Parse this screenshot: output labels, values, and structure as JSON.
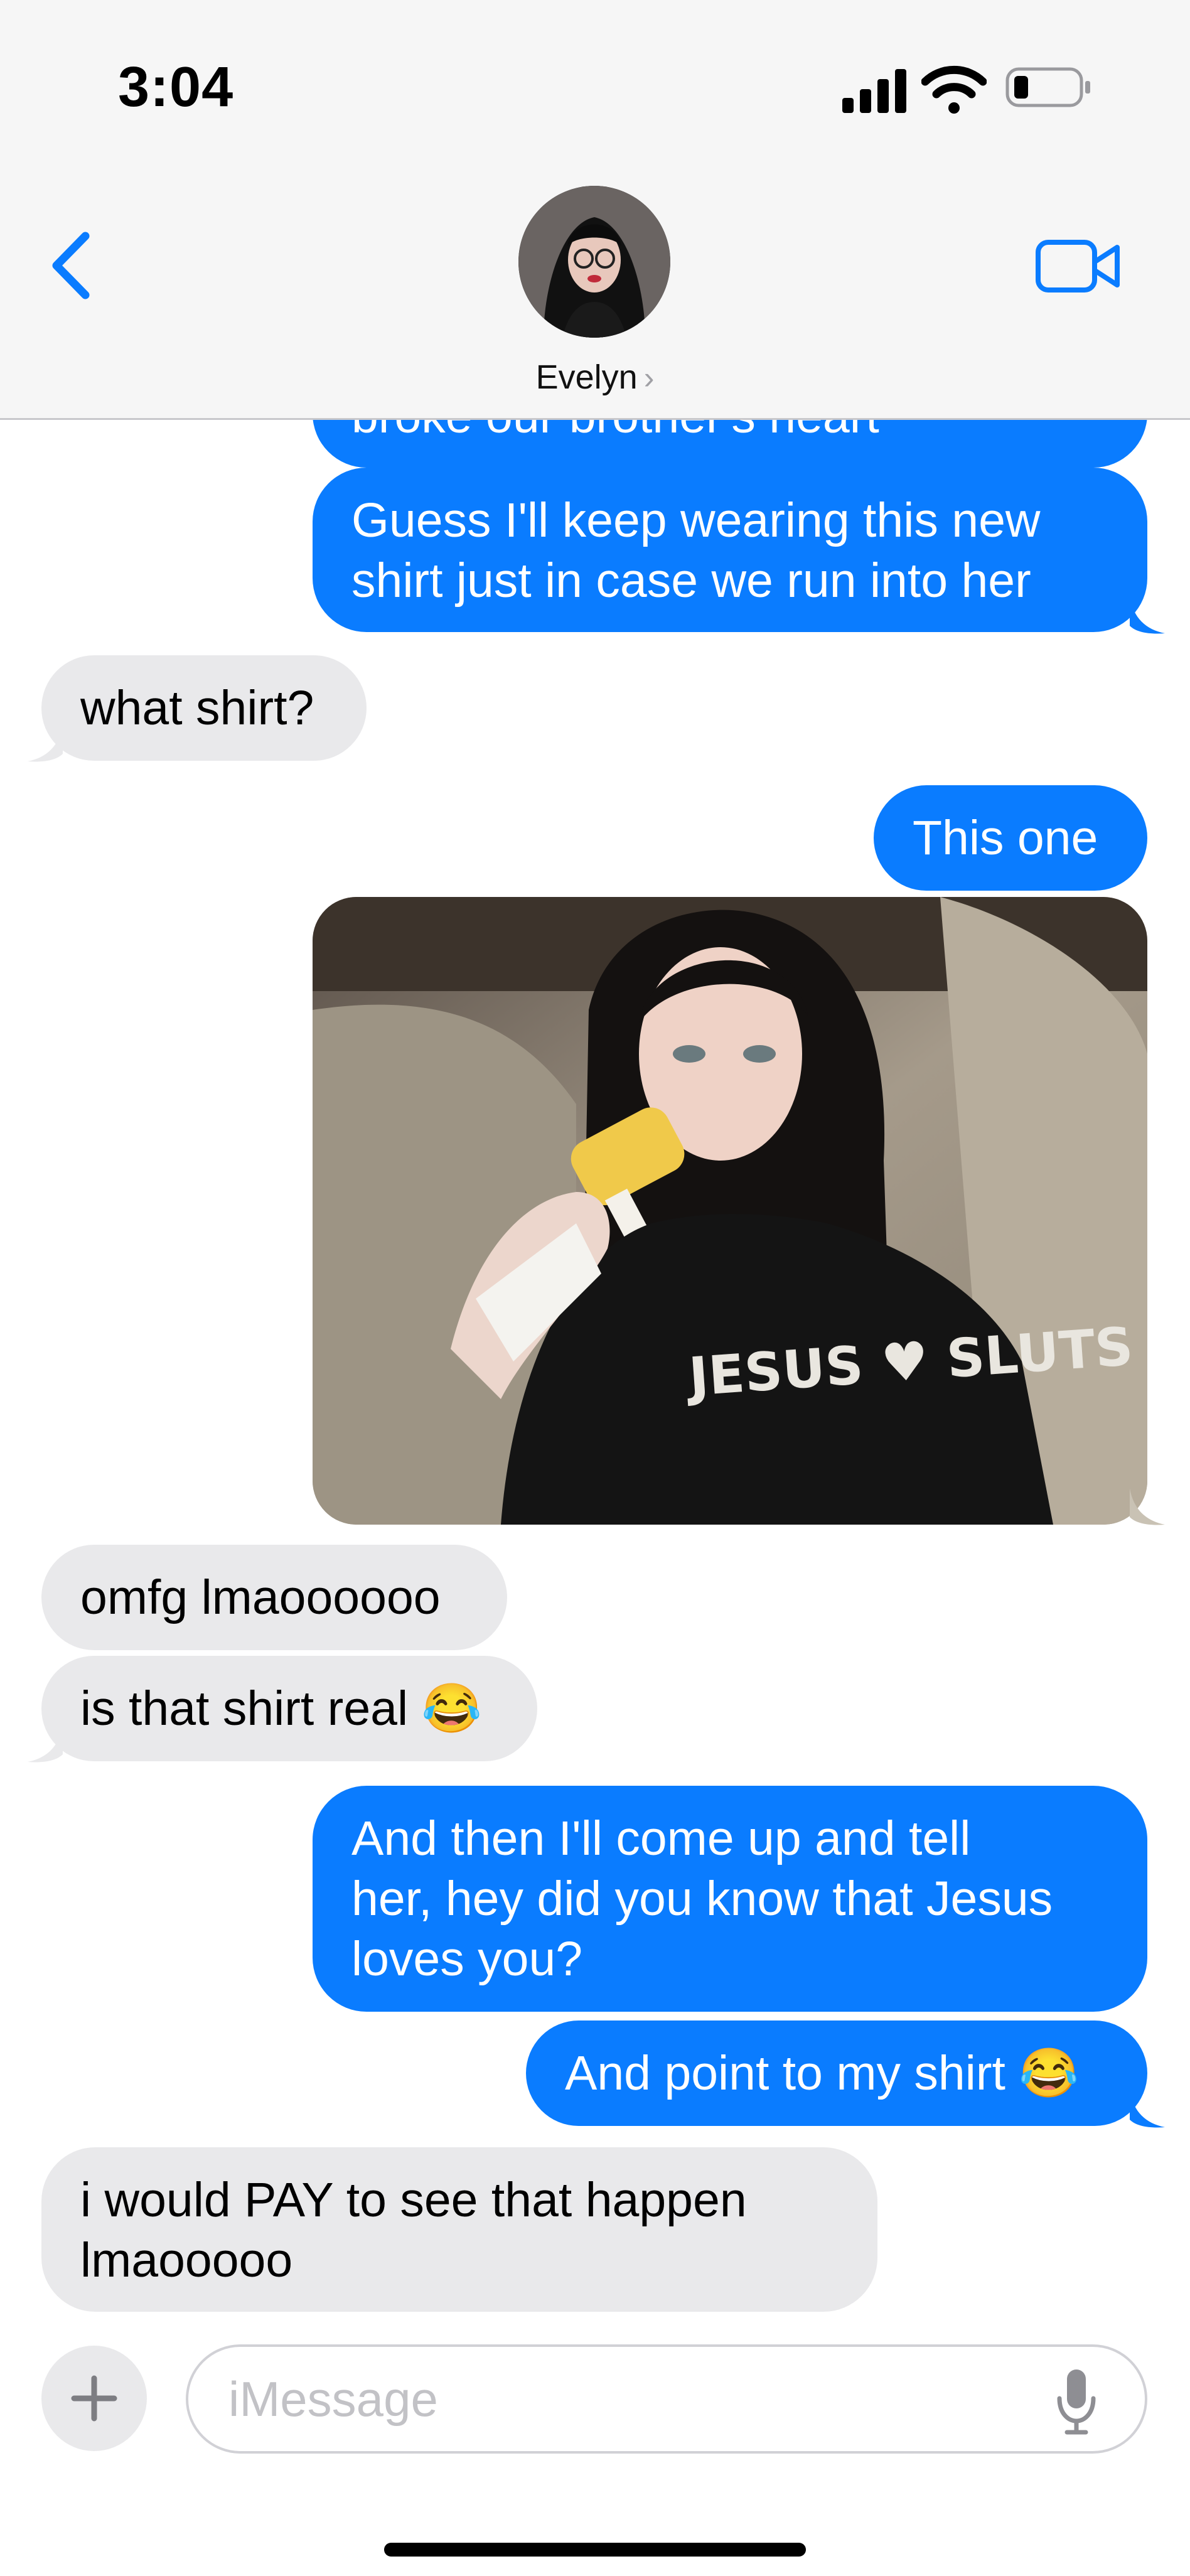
{
  "status": {
    "time": "3:04"
  },
  "header": {
    "contact_name": "Evelyn",
    "chevron": "›"
  },
  "messages": [
    {
      "from": "me",
      "text": "broke our brother's heart"
    },
    {
      "from": "me",
      "text": "Guess I'll keep wearing this new\nshirt just in case we run into her"
    },
    {
      "from": "them",
      "text": "what shirt?"
    },
    {
      "from": "me",
      "text": "This one"
    },
    {
      "from": "me",
      "type": "photo",
      "shirt_text": "JESUS ♥ SLUTS"
    },
    {
      "from": "them",
      "text": "omfg lmaoooooo"
    },
    {
      "from": "them",
      "text": "is that shirt real 😂"
    },
    {
      "from": "me",
      "text": "And then I'll come up and tell\nher, hey did you know that Jesus\nloves you?"
    },
    {
      "from": "me",
      "text": "And point to my shirt 😂"
    },
    {
      "from": "them",
      "text": "i would PAY to see that happen\nlmaooooo"
    }
  ],
  "composer": {
    "placeholder": "iMessage",
    "plus_label": "+"
  },
  "colors": {
    "sent": "#0a7cff",
    "received": "#e9e9eb",
    "accent": "#0a7cff"
  },
  "icons": [
    "signal-icon",
    "wifi-icon",
    "battery-icon",
    "back-chevron-icon",
    "video-call-icon",
    "plus-icon",
    "microphone-icon"
  ]
}
